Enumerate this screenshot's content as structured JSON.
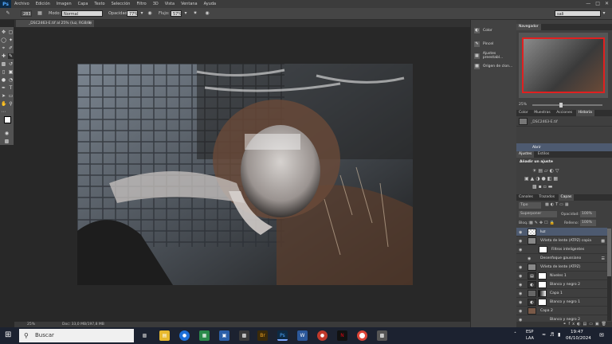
{
  "menubar": {
    "logo": "Ps",
    "items": [
      "Archivo",
      "Edición",
      "Imagen",
      "Capa",
      "Texto",
      "Selección",
      "Filtro",
      "3D",
      "Vista",
      "Ventana",
      "Ayuda"
    ]
  },
  "options": {
    "brush_size": "283",
    "mode_label": "Modo:",
    "mode_value": "Normal",
    "opacity_label": "Opacidad:",
    "opacity_value": "77%",
    "flow_label": "Flujo:",
    "flow_value": "57%",
    "workspace_value": "sali"
  },
  "document": {
    "tab_title": "_DSC2463-E.tif al 25% (luz, RGB/8)",
    "zoom": "25%",
    "doc_info": "Doc: 33,0 MB/197,8 MB"
  },
  "mini_panel": {
    "items": [
      "Color",
      "Pincel",
      "Ajustes preestabl...",
      "Origen de clon..."
    ]
  },
  "navigator": {
    "title": "Navegador",
    "zoom": "25%"
  },
  "history": {
    "tabs": [
      "Color",
      "Muestras",
      "Acciones",
      "Historia"
    ],
    "snapshot": "_DSC2463-E.tif",
    "step": "Abrir"
  },
  "adjustments": {
    "tabs": [
      "Ajustes",
      "Estilos"
    ],
    "title": "Añadir un ajuste"
  },
  "layers": {
    "tabs": [
      "Canales",
      "Trazados",
      "Capas"
    ],
    "filter_label": "Tipo",
    "blend_mode": "Superponer",
    "opacity_label": "Opacidad:",
    "opacity_value": "100%",
    "lock_label": "Bloq.:",
    "fill_label": "Relleno:",
    "fill_value": "100%",
    "rows": [
      {
        "name": "luz",
        "selected": true
      },
      {
        "name": "Viñeta de lente (ATPZ) copia"
      },
      {
        "name": "Filtros inteligentes"
      },
      {
        "name": "Desenfoque gaussiano"
      },
      {
        "name": "Viñeta de lente (ATPZ)"
      },
      {
        "name": "Niveles 1"
      },
      {
        "name": "Blanco y negro 2"
      },
      {
        "name": "Capa 1"
      },
      {
        "name": "Blanco y negro 1"
      },
      {
        "name": "Capa 2"
      },
      {
        "name": "Blanco y negro 2"
      }
    ]
  },
  "taskbar": {
    "search_placeholder": "Buscar",
    "lang": "ESP",
    "lang2": "LAA",
    "time": "19:47",
    "date": "06/10/2024"
  }
}
